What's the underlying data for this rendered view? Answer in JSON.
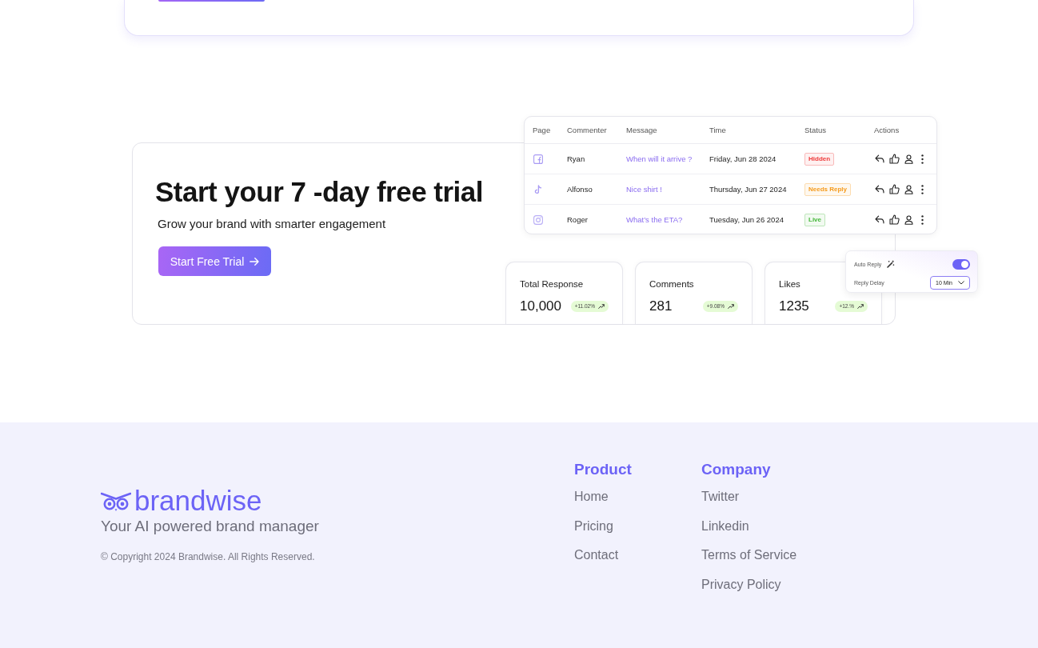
{
  "cta": {
    "title": "Start your 7 -day free trial",
    "subtitle": "Grow your brand with smarter engagement",
    "button": "Start Free Trial"
  },
  "comments_table": {
    "columns": [
      "Page",
      "Commenter",
      "Message",
      "Time",
      "Status",
      "Actions"
    ],
    "rows": [
      {
        "kind": "facebook",
        "commenter": "Ryan",
        "message": "When will it arrive ?",
        "time": "Friday, Jun 28 2024",
        "status": {
          "label": "Hidden",
          "color": "#ef3b3b"
        }
      },
      {
        "kind": "tiktok",
        "commenter": "Alfonso",
        "message": "Nice shirt !",
        "time": "Thursday, Jun 27 2024",
        "status": {
          "label": "Needs Reply",
          "color": "#f59a1b"
        }
      },
      {
        "kind": "instagram",
        "commenter": "Roger",
        "message": "What’s the ETA?",
        "time": "Tuesday, Jun 26 2024",
        "status": {
          "label": "Live",
          "color": "#45b83a"
        }
      }
    ]
  },
  "stats": [
    {
      "label": "Total Response",
      "value": "10,000",
      "change": "+11.02%"
    },
    {
      "label": "Comments",
      "value": "281",
      "change": "+9.08%"
    },
    {
      "label": "Likes",
      "value": "1235",
      "change": "+12.%"
    }
  ],
  "auto_reply": {
    "label": "Auto Reply",
    "on": true
  },
  "reply_delay": {
    "label": "Reply Delay",
    "value": "10 Min"
  },
  "footer": {
    "brand": "brandwise",
    "tagline": "Your AI powered brand manager",
    "copyright": "© Copyright 2024 Brandwise. All Rights Reserved.",
    "columns": [
      {
        "heading": "Product",
        "links": [
          "Home",
          "Pricing",
          "Contact"
        ]
      },
      {
        "heading": "Company",
        "links": [
          "Twitter",
          "Linkedin",
          "Terms of Service",
          "Privacy Policy"
        ]
      }
    ]
  }
}
